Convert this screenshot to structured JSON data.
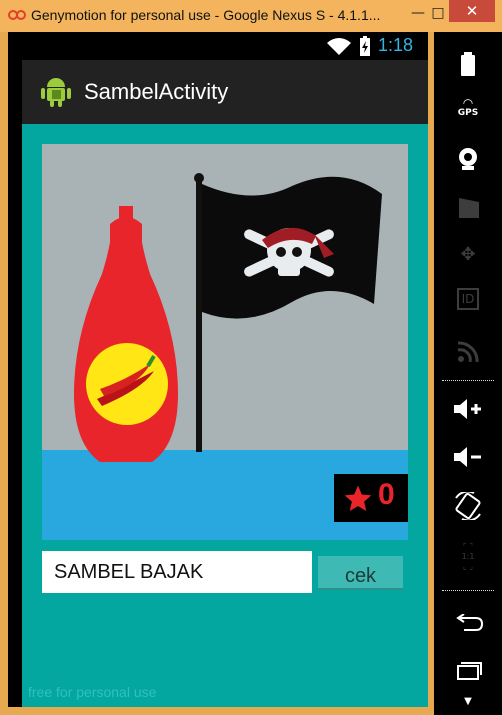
{
  "window": {
    "title": "Genymotion for personal use - Google Nexus S - 4.1.1...",
    "minimize_glyph": "—",
    "maximize_glyph": "□",
    "close_glyph": "✕"
  },
  "status_bar": {
    "time": "1:18",
    "accent_color": "#34b5e5"
  },
  "action_bar": {
    "title": "SambelActivity",
    "icon": "android-icon"
  },
  "puzzle": {
    "image_description_icons": [
      "chili-sauce-bottle",
      "pirate-flag"
    ],
    "score_icon": "star-icon",
    "score": "0"
  },
  "answer": {
    "value": "SAMBEL BAJAK",
    "button_label": "cek"
  },
  "watermark": "free for personal use",
  "sidebar": {
    "items": [
      {
        "name": "battery-icon",
        "label": ""
      },
      {
        "name": "gps-icon",
        "label": "GPS"
      },
      {
        "name": "camera-icon",
        "label": ""
      },
      {
        "name": "video-icon",
        "label": ""
      },
      {
        "name": "dpad-icon",
        "label": ""
      },
      {
        "name": "id-icon",
        "label": "ID"
      },
      {
        "name": "rss-icon",
        "label": ""
      },
      {
        "name": "volume-up-icon",
        "label": ""
      },
      {
        "name": "volume-down-icon",
        "label": ""
      },
      {
        "name": "rotate-icon",
        "label": ""
      },
      {
        "name": "scale-icon",
        "label": "1:1"
      },
      {
        "name": "back-icon",
        "label": ""
      },
      {
        "name": "recent-apps-icon",
        "label": ""
      }
    ]
  },
  "colors": {
    "content_bg": "#03a7a0",
    "sky": "#a9b3b6",
    "sea": "#29a8df",
    "bottle_red": "#e8252b",
    "label_yellow": "#ffe614"
  }
}
